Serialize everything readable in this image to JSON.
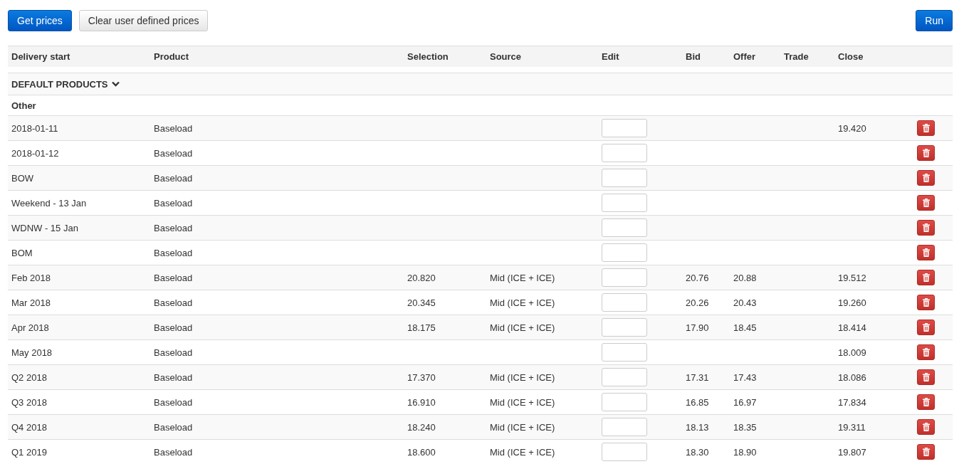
{
  "toolbar": {
    "left_buttons": [
      {
        "label": "Get prices",
        "kind": "primary"
      },
      {
        "label": "Clear user defined prices",
        "kind": "default"
      }
    ],
    "right_buttons": [
      {
        "label": "Run",
        "kind": "primary"
      }
    ]
  },
  "table": {
    "columns": [
      "Delivery start",
      "Product",
      "Selection",
      "Source",
      "Edit",
      "Bid",
      "Offer",
      "Trade",
      "Close"
    ],
    "section": {
      "title": "DEFAULT PRODUCTS",
      "expanded": true
    },
    "group": "Other",
    "rows": [
      {
        "delivery_start": "2018-01-11",
        "product": "Baseload",
        "selection": "",
        "source": "",
        "bid": "",
        "offer": "",
        "trade": "",
        "close": "19.420"
      },
      {
        "delivery_start": "2018-01-12",
        "product": "Baseload",
        "selection": "",
        "source": "",
        "bid": "",
        "offer": "",
        "trade": "",
        "close": ""
      },
      {
        "delivery_start": "BOW",
        "product": "Baseload",
        "selection": "",
        "source": "",
        "bid": "",
        "offer": "",
        "trade": "",
        "close": ""
      },
      {
        "delivery_start": "Weekend - 13 Jan",
        "product": "Baseload",
        "selection": "",
        "source": "",
        "bid": "",
        "offer": "",
        "trade": "",
        "close": ""
      },
      {
        "delivery_start": "WDNW - 15 Jan",
        "product": "Baseload",
        "selection": "",
        "source": "",
        "bid": "",
        "offer": "",
        "trade": "",
        "close": ""
      },
      {
        "delivery_start": "BOM",
        "product": "Baseload",
        "selection": "",
        "source": "",
        "bid": "",
        "offer": "",
        "trade": "",
        "close": ""
      },
      {
        "delivery_start": "Feb 2018",
        "product": "Baseload",
        "selection": "20.820",
        "source": "Mid (ICE + ICE)",
        "bid": "20.76",
        "offer": "20.88",
        "trade": "",
        "close": "19.512"
      },
      {
        "delivery_start": "Mar 2018",
        "product": "Baseload",
        "selection": "20.345",
        "source": "Mid (ICE + ICE)",
        "bid": "20.26",
        "offer": "20.43",
        "trade": "",
        "close": "19.260"
      },
      {
        "delivery_start": "Apr 2018",
        "product": "Baseload",
        "selection": "18.175",
        "source": "Mid (ICE + ICE)",
        "bid": "17.90",
        "offer": "18.45",
        "trade": "",
        "close": "18.414"
      },
      {
        "delivery_start": "May 2018",
        "product": "Baseload",
        "selection": "",
        "source": "",
        "bid": "",
        "offer": "",
        "trade": "",
        "close": "18.009"
      },
      {
        "delivery_start": "Q2 2018",
        "product": "Baseload",
        "selection": "17.370",
        "source": "Mid (ICE + ICE)",
        "bid": "17.31",
        "offer": "17.43",
        "trade": "",
        "close": "18.086"
      },
      {
        "delivery_start": "Q3 2018",
        "product": "Baseload",
        "selection": "16.910",
        "source": "Mid (ICE + ICE)",
        "bid": "16.85",
        "offer": "16.97",
        "trade": "",
        "close": "17.834"
      },
      {
        "delivery_start": "Q4 2018",
        "product": "Baseload",
        "selection": "18.240",
        "source": "Mid (ICE + ICE)",
        "bid": "18.13",
        "offer": "18.35",
        "trade": "",
        "close": "19.311"
      },
      {
        "delivery_start": "Q1 2019",
        "product": "Baseload",
        "selection": "18.600",
        "source": "Mid (ICE + ICE)",
        "bid": "18.30",
        "offer": "18.90",
        "trade": "",
        "close": "19.807"
      }
    ]
  }
}
